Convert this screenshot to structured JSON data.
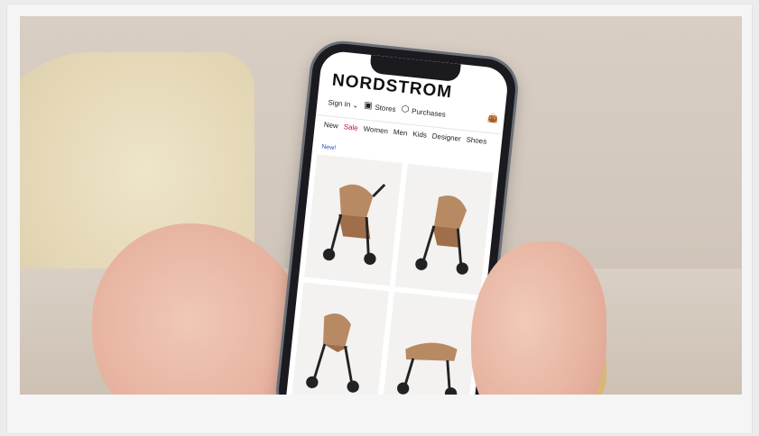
{
  "photo": {
    "alt": "Hands holding a smartphone showing the Nordstrom app with strollers"
  },
  "app": {
    "brand": "NORDSTROM",
    "sign_in": "Sign In ⌄",
    "stores": "Stores",
    "purchases": "Purchases",
    "nav": [
      "New",
      "Sale",
      "Women",
      "Men",
      "Kids",
      "Designer",
      "Shoes"
    ],
    "new_badge": "New!"
  },
  "icons": {
    "stores": "storefront-icon",
    "purchases": "box-icon",
    "bag": "shopping-bag-icon"
  },
  "colors": {
    "sale": "#c8102e",
    "badge": "#2b4fbf",
    "brand": "#111111"
  }
}
